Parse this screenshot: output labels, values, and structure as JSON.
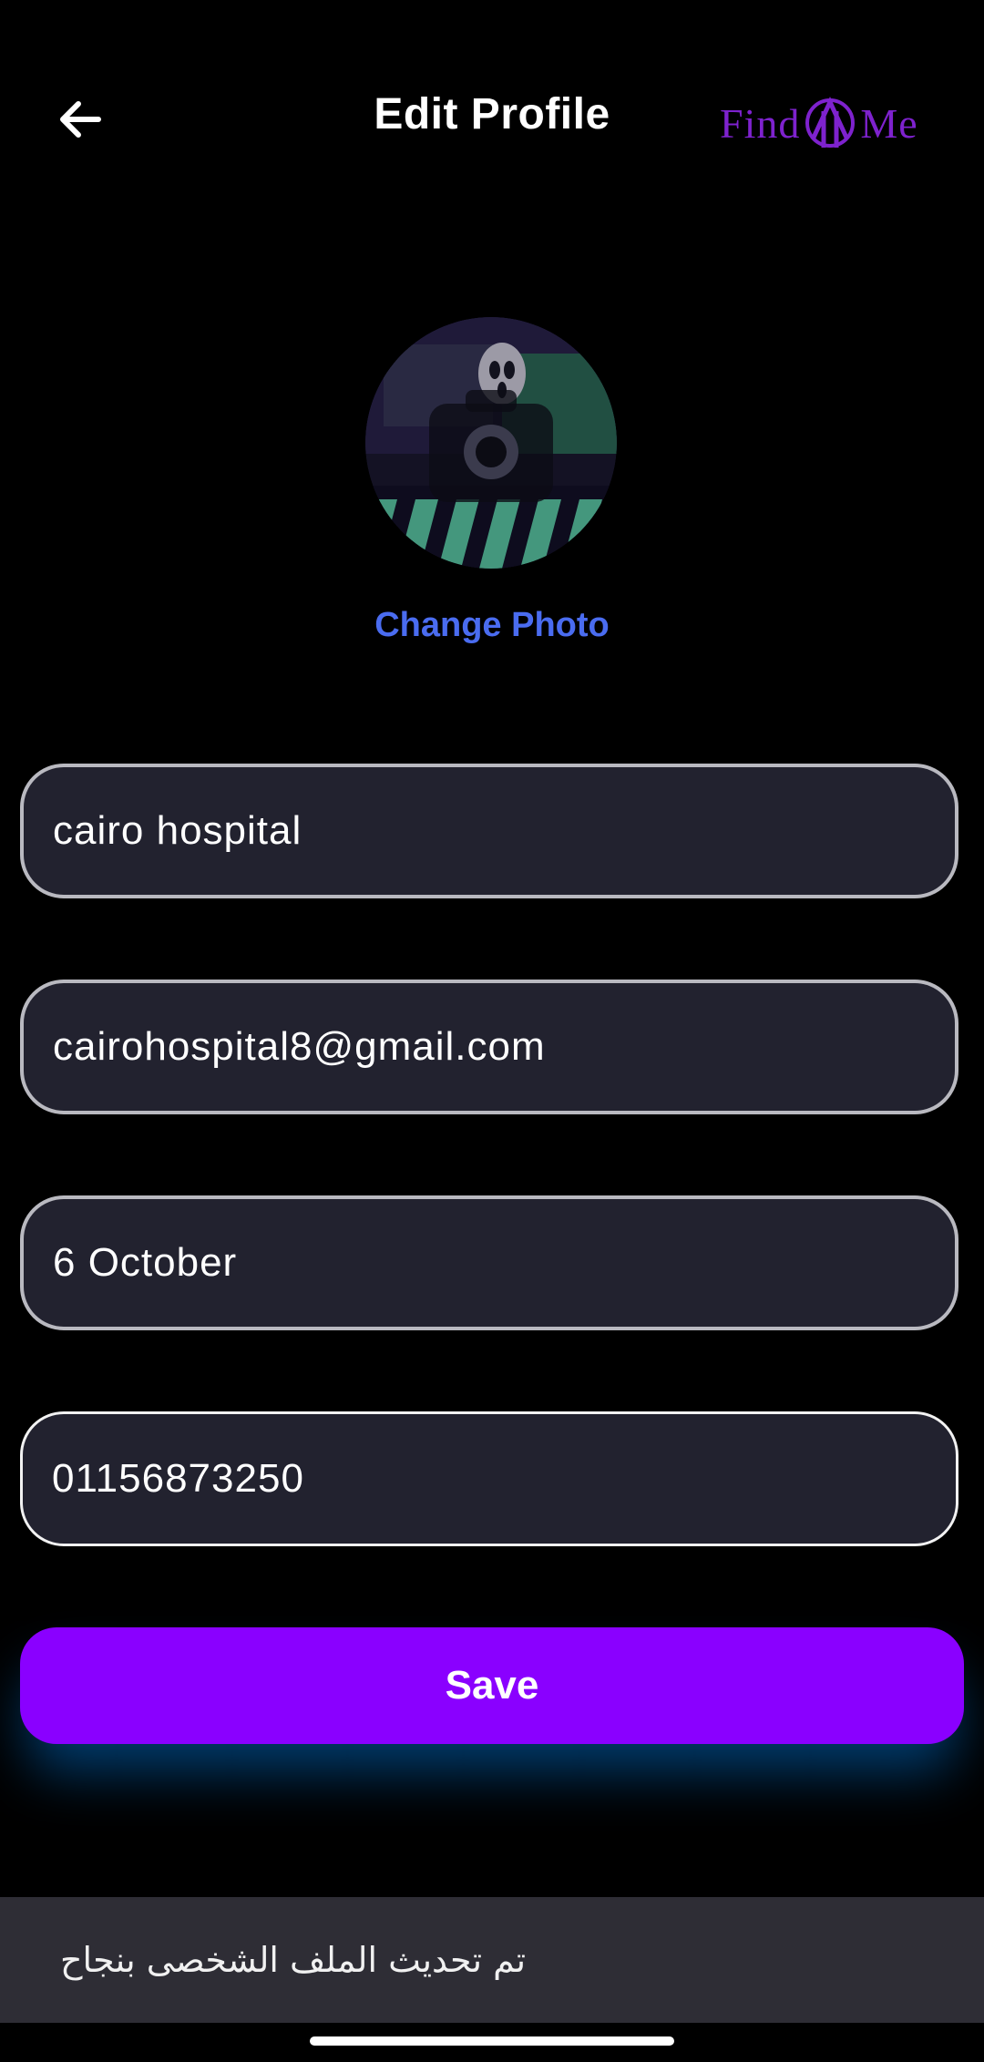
{
  "header": {
    "title": "Edit Profile",
    "back_icon": "arrow-left-icon",
    "logo": {
      "text_left": "Find",
      "text_right": "Me",
      "color": "#7e22ce"
    }
  },
  "profile": {
    "avatar_overlay_icon": "camera-icon",
    "change_photo_label": "Change Photo",
    "change_photo_color": "#4a6cf0"
  },
  "form": {
    "name_value": "cairo hospital",
    "email_value": "cairohospital8@gmail.com",
    "address_value": "6 October",
    "phone_value": "01156873250"
  },
  "actions": {
    "save_label": "Save",
    "save_color": "#8a00ff"
  },
  "snackbar": {
    "message": "تم تحديث الملف الشخصى بنجاح"
  }
}
